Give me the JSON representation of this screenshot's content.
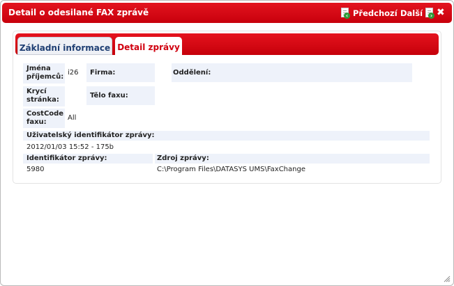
{
  "dialog": {
    "title": "Detail o odesilané FAX zprávě",
    "prev_label": "Předchozí",
    "next_label": "Další",
    "close_glyph": "✖"
  },
  "tabs": [
    {
      "label": "Základní informace",
      "active": false
    },
    {
      "label": "Detail zprávy",
      "active": true
    }
  ],
  "fields": {
    "recipients_label": "Jména příjemců:",
    "recipients_value": "i26",
    "company_label": "Firma:",
    "company_value": "",
    "department_label": "Oddělení:",
    "department_value": "",
    "cover_label": "Krycí stránka:",
    "cover_value": "",
    "body_label": "Tělo faxu:",
    "body_value": "",
    "costcode_label": "CostCode faxu:",
    "costcode_value": "All",
    "user_id_label": "Uživatelský identifikátor zprávy:",
    "user_id_value": "2012/01/03 15:52 - 175b",
    "msg_id_label": "Identifikátor zprávy:",
    "msg_id_value": "5980",
    "source_label": "Zdroj zprávy:",
    "source_value": "C:\\Program Files\\DATASYS UMS\\FaxChange"
  },
  "colors": {
    "accent_red": "#d0000f",
    "field_bg": "#eef2fa",
    "tab_text_blue": "#1f3f73"
  },
  "icons": [
    "previous-document-icon",
    "next-document-icon",
    "close-icon",
    "resize-grip-icon"
  ]
}
